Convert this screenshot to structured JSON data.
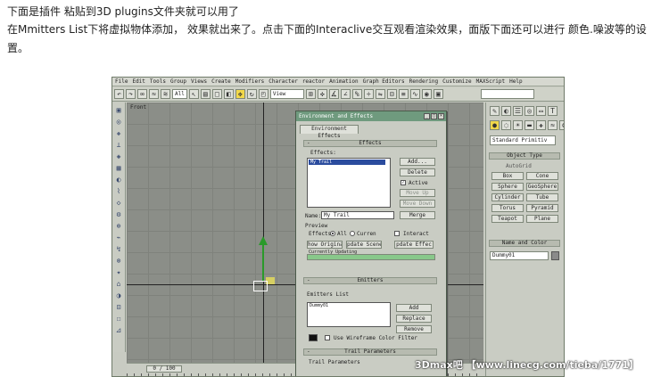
{
  "captions": {
    "line1": "下面是插件 粘贴到3D plugins文件夹就可以用了",
    "line2": "在Mmitters List下将虚拟物体添加， 效果就出来了。点击下面的Interaclive交互观看渲染效果，面版下面还可以进行 颜色.噪波等的设",
    "line3": "置。"
  },
  "app": {
    "menu": [
      "File",
      "Edit",
      "Tools",
      "Group",
      "Views",
      "Create",
      "Modifiers",
      "Character",
      "reactor",
      "Animation",
      "Graph Editors",
      "Rendering",
      "Customize",
      "MAXScript",
      "Help"
    ],
    "toolbar": {
      "selection_filter": "All",
      "ref_coord": "View"
    },
    "viewport": {
      "label": "Front"
    },
    "timeline": {
      "slider": "0 / 100"
    },
    "command_panel": {
      "dropdown": "Standard Primitiv",
      "object_type_title": "Object Type",
      "autogrid": "AutoGrid",
      "primitives": [
        "Box",
        "Cone",
        "Sphere",
        "GeoSphere",
        "Cylinder",
        "Tube",
        "Torus",
        "Pyramid",
        "Teapot",
        "Plane"
      ],
      "name_color_title": "Name and Color",
      "name": "Dummy01"
    },
    "dialog": {
      "title": "Environment and Effects",
      "tab": "Environment Effects",
      "effects_section": "Effects",
      "effects_label": "Effects:",
      "effects_item": "My Trail",
      "buttons": {
        "add": "Add...",
        "delete": "Delete",
        "move_up": "Move Up",
        "move_down": "Move Down",
        "merge": "Merge",
        "show_original": "how Original",
        "update_scene": "pdate Scene",
        "update_effect": "pdate Effec"
      },
      "active_label": "Active",
      "name_label": "Name:",
      "name_value": "My Trail",
      "preview_title": "Preview",
      "preview_effects_label": "Effects:",
      "preview_all": "All",
      "preview_current": "Curren",
      "interactive_label": "Interact",
      "status": "Currently Updating",
      "progress": 1.0,
      "emitters_section": "Emitters",
      "emitters_list_title": "Emitters List",
      "emitters_item": "Dummy01",
      "emitters_buttons": {
        "add": "Add",
        "replace": "Replace",
        "remove": "Remove"
      },
      "wireframe_label": "Use Wireframe Color Filter",
      "trail_params_section": "Trail Parameters",
      "trail_params_sub": "Trail Parameters"
    }
  },
  "watermark": "3Dmax吧 【www.linecg.com/tieba/1771】"
}
